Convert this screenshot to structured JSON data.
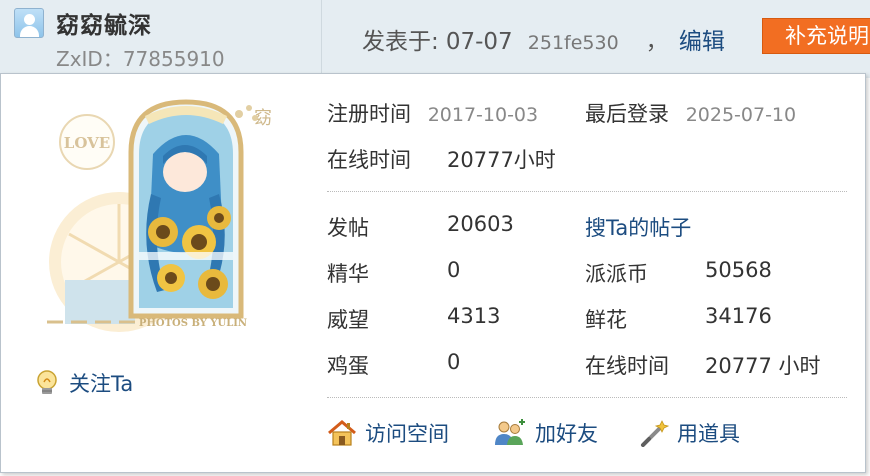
{
  "header": {
    "username": "窈窈毓深",
    "zxid": "ZxID：77855910",
    "post_label": "发表于:",
    "post_date": "07-07",
    "post_hash": "251fe530",
    "comma": "，",
    "edit_label": "编辑",
    "supplement_label": "补充说明"
  },
  "profile": {
    "follow_label": "关注Ta",
    "avatar_caption": "LOVE",
    "avatar_mark": "窈",
    "avatar_watermark": "PHOTOS BY YULIN",
    "register_label": "注册时间",
    "register_value": "2017-10-03",
    "lastlogin_label": "最后登录",
    "lastlogin_value": "2025-07-10",
    "online_label": "在线时间",
    "online_value": "20777小时",
    "stats": {
      "posts_label": "发帖",
      "posts_value": "20603",
      "search_posts_link": "搜Ta的帖子",
      "essence_label": "精华",
      "essence_value": "0",
      "coins_label": "派派币",
      "coins_value": "50568",
      "prestige_label": "威望",
      "prestige_value": "4313",
      "flowers_label": "鲜花",
      "flowers_value": "34176",
      "eggs_label": "鸡蛋",
      "eggs_value": "0",
      "online2_label": "在线时间",
      "online2_value": "20777 小时"
    },
    "actions": {
      "visit_space": "访问空间",
      "add_friend": "加好友",
      "use_item": "用道具"
    }
  },
  "colors": {
    "link": "#1c4c80",
    "supplement_button": "#f26e22",
    "header_bg": "#e5edf2"
  }
}
